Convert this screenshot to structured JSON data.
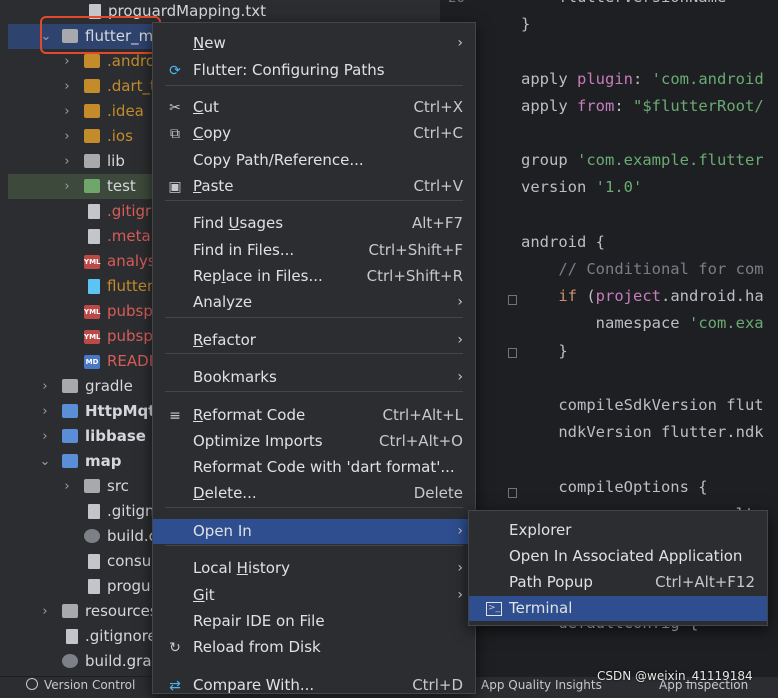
{
  "tree": {
    "rows": [
      {
        "label": "proguardMapping.txt"
      },
      {
        "label": "flutter_m"
      },
      {
        "label": ".andro"
      },
      {
        "label": ".dart_t"
      },
      {
        "label": ".idea"
      },
      {
        "label": ".ios"
      },
      {
        "label": "lib"
      },
      {
        "label": "test"
      },
      {
        "label": ".gitigr"
      },
      {
        "label": ".meta"
      },
      {
        "label": "analys"
      },
      {
        "label": "flutter"
      },
      {
        "label": "pubsp"
      },
      {
        "label": "pubsp"
      },
      {
        "label": "READI"
      },
      {
        "label": "gradle"
      },
      {
        "label": "HttpMqt"
      },
      {
        "label": "libbase"
      },
      {
        "label": "map"
      },
      {
        "label": "src"
      },
      {
        "label": ".gitign"
      },
      {
        "label": "build.c"
      },
      {
        "label": "consu"
      },
      {
        "label": "progu"
      },
      {
        "label": "resources"
      },
      {
        "label": ".gitignore"
      },
      {
        "label": "build.gra"
      }
    ],
    "yml_badge": "YML",
    "md_badge": "MD"
  },
  "editor": {
    "line_number_partial": "26",
    "lines": [
      {
        "tokens": [
          {
            "c": "t",
            "v": "    flutterVersionName"
          }
        ]
      },
      {
        "tokens": [
          {
            "c": "t",
            "v": "}"
          }
        ]
      },
      {
        "tokens": []
      },
      {
        "tokens": [
          {
            "c": "t",
            "v": "apply "
          },
          {
            "c": "p",
            "v": "plugin"
          },
          {
            "c": "t",
            "v": ": "
          },
          {
            "c": "s",
            "v": "'com.android"
          }
        ]
      },
      {
        "tokens": [
          {
            "c": "t",
            "v": "apply "
          },
          {
            "c": "p",
            "v": "from"
          },
          {
            "c": "t",
            "v": ": "
          },
          {
            "c": "s",
            "v": "\"$flutterRoot/"
          }
        ]
      },
      {
        "tokens": []
      },
      {
        "tokens": [
          {
            "c": "t",
            "v": "group "
          },
          {
            "c": "s",
            "v": "'com.example.flutter"
          }
        ]
      },
      {
        "tokens": [
          {
            "c": "t",
            "v": "version "
          },
          {
            "c": "s",
            "v": "'1.0'"
          }
        ]
      },
      {
        "tokens": []
      },
      {
        "tokens": [
          {
            "c": "t",
            "v": "android {"
          }
        ]
      },
      {
        "tokens": [
          {
            "c": "cm",
            "v": "    // Conditional for com"
          }
        ]
      },
      {
        "tokens": [
          {
            "c": "k",
            "v": "    if "
          },
          {
            "c": "t",
            "v": "("
          },
          {
            "c": "p",
            "v": "project"
          },
          {
            "c": "t",
            "v": ".android.ha"
          }
        ]
      },
      {
        "tokens": [
          {
            "c": "t",
            "v": "        namespace "
          },
          {
            "c": "s",
            "v": "'com.exa"
          }
        ]
      },
      {
        "tokens": [
          {
            "c": "t",
            "v": "    }"
          }
        ]
      },
      {
        "tokens": []
      },
      {
        "tokens": [
          {
            "c": "t",
            "v": "    compileSdkVersion flut"
          }
        ]
      },
      {
        "tokens": [
          {
            "c": "t",
            "v": "    ndkVersion flutter.ndk"
          }
        ]
      },
      {
        "tokens": []
      },
      {
        "tokens": [
          {
            "c": "t",
            "v": "    compileOptions {"
          }
        ]
      },
      {
        "tokens": [
          {
            "c": "t",
            "v": "                       lt"
          }
        ]
      },
      {
        "tokens": [
          {
            "c": "t",
            "v": "                       lt"
          }
        ]
      },
      {
        "tokens": []
      },
      {
        "tokens": []
      },
      {
        "tokens": [
          {
            "c": "t",
            "v": "    defaultConfig {"
          }
        ]
      }
    ]
  },
  "context_menu": {
    "items": [
      {
        "label": "New",
        "shortcut": "",
        "submenu": true,
        "icon": ""
      },
      {
        "label": "Flutter: Configuring Paths",
        "shortcut": "",
        "submenu": false,
        "icon": "flutter-icon"
      },
      {
        "label": "Cut",
        "shortcut": "Ctrl+X",
        "submenu": false,
        "icon": "scissors-icon"
      },
      {
        "label": "Copy",
        "shortcut": "Ctrl+C",
        "submenu": false,
        "icon": "copy-icon"
      },
      {
        "label": "Copy Path/Reference...",
        "shortcut": "",
        "submenu": false,
        "icon": ""
      },
      {
        "label": "Paste",
        "shortcut": "Ctrl+V",
        "submenu": false,
        "icon": "clipboard-icon"
      },
      {
        "label": "Find Usages",
        "shortcut": "Alt+F7",
        "submenu": false,
        "icon": ""
      },
      {
        "label": "Find in Files...",
        "shortcut": "Ctrl+Shift+F",
        "submenu": false,
        "icon": ""
      },
      {
        "label": "Replace in Files...",
        "shortcut": "Ctrl+Shift+R",
        "submenu": false,
        "icon": ""
      },
      {
        "label": "Analyze",
        "shortcut": "",
        "submenu": true,
        "icon": ""
      },
      {
        "label": "Refactor",
        "shortcut": "",
        "submenu": true,
        "icon": ""
      },
      {
        "label": "Bookmarks",
        "shortcut": "",
        "submenu": true,
        "icon": ""
      },
      {
        "label": "Reformat Code",
        "shortcut": "Ctrl+Alt+L",
        "submenu": false,
        "icon": "reformat-icon"
      },
      {
        "label": "Optimize Imports",
        "shortcut": "Ctrl+Alt+O",
        "submenu": false,
        "icon": ""
      },
      {
        "label": "Reformat Code with 'dart format'...",
        "shortcut": "",
        "submenu": false,
        "icon": ""
      },
      {
        "label": "Delete...",
        "shortcut": "Delete",
        "submenu": false,
        "icon": ""
      },
      {
        "label": "Open In",
        "shortcut": "",
        "submenu": true,
        "icon": ""
      },
      {
        "label": "Local History",
        "shortcut": "",
        "submenu": true,
        "icon": ""
      },
      {
        "label": "Git",
        "shortcut": "",
        "submenu": true,
        "icon": ""
      },
      {
        "label": "Repair IDE on File",
        "shortcut": "",
        "submenu": false,
        "icon": ""
      },
      {
        "label": "Reload from Disk",
        "shortcut": "",
        "submenu": false,
        "icon": "reload-icon"
      },
      {
        "label": "Compare With...",
        "shortcut": "Ctrl+D",
        "submenu": false,
        "icon": "compare-icon"
      }
    ],
    "submenu_glyph": "›"
  },
  "open_in_submenu": {
    "items": [
      {
        "label": "Explorer",
        "shortcut": ""
      },
      {
        "label": "Open In Associated Application",
        "shortcut": ""
      },
      {
        "label": "Path Popup",
        "shortcut": "Ctrl+Alt+F12"
      },
      {
        "label": "Terminal",
        "shortcut": ""
      }
    ]
  },
  "status_bar": {
    "version_control": "Version Control",
    "app_quality": "App Quality Insights",
    "app_inspection": "App Inspection",
    "watermark": "CSDN @weixin_41119184"
  },
  "colors": {
    "selection": "#2e4e8f",
    "highlight_box": "#e24a2c"
  }
}
